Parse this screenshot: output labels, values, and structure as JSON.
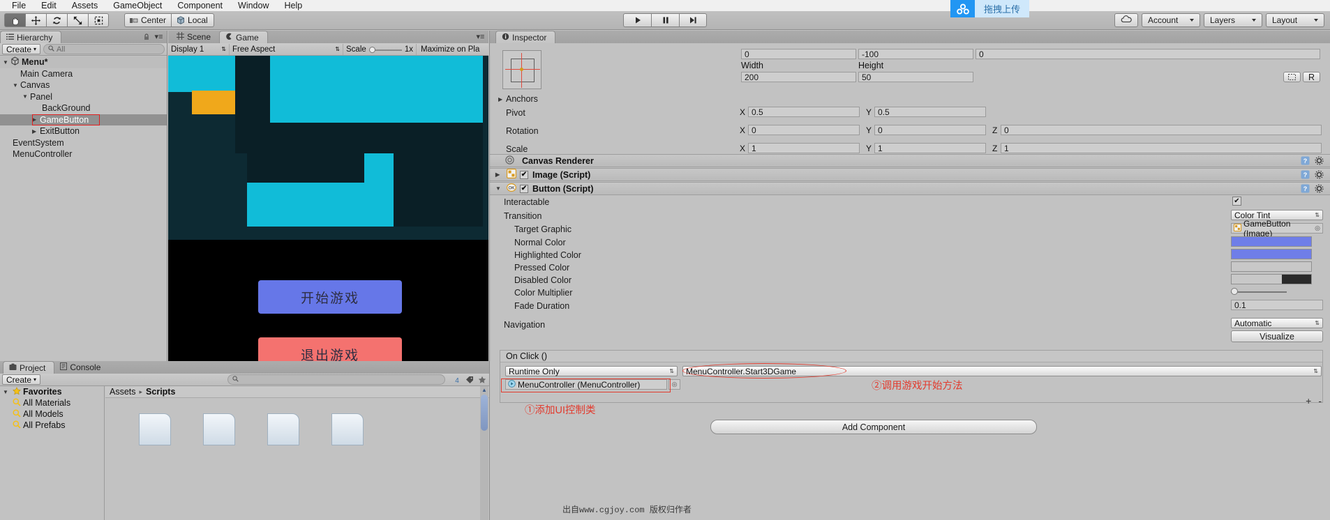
{
  "menubar": {
    "items": [
      "File",
      "Edit",
      "Assets",
      "GameObject",
      "Component",
      "Window",
      "Help"
    ]
  },
  "toolbar": {
    "tools": [
      {
        "name": "hand-tool",
        "icon": "hand-icon",
        "active": true
      },
      {
        "name": "move-tool",
        "icon": "move-arrows-icon",
        "active": false
      },
      {
        "name": "rotate-tool",
        "icon": "rotate-icon",
        "active": false
      },
      {
        "name": "scale-tool",
        "icon": "scale-icon",
        "active": false
      },
      {
        "name": "rect-tool",
        "icon": "rect-transform-icon",
        "active": false
      }
    ],
    "pivot_label": "Center",
    "space_label": "Local",
    "play_label": "play-icon",
    "pause_label": "pause-icon",
    "step_label": "step-icon",
    "cloud_label": "cloud-icon",
    "account_label": "Account",
    "layers_label": "Layers",
    "layout_label": "Layout"
  },
  "upload_widget": {
    "label": "拖拽上传",
    "icon": "cloud-upload-icon",
    "accent": "#2196f3"
  },
  "hierarchy": {
    "tab_label": "Hierarchy",
    "create_label": "Create",
    "search_placeholder": "All",
    "selected": "GameButton",
    "items": [
      {
        "label": "Menu*",
        "depth": 0,
        "arrow": "down",
        "root": true,
        "selected": false
      },
      {
        "label": "Main Camera",
        "depth": 1,
        "arrow": "none",
        "selected": false
      },
      {
        "label": "Canvas",
        "depth": 1,
        "arrow": "down",
        "selected": false
      },
      {
        "label": "Panel",
        "depth": 2,
        "arrow": "down",
        "selected": false
      },
      {
        "label": "BackGround",
        "depth": 3,
        "arrow": "none",
        "selected": false
      },
      {
        "label": "GameButton",
        "depth": 3,
        "arrow": "right",
        "selected": true
      },
      {
        "label": "ExitButton",
        "depth": 3,
        "arrow": "right",
        "selected": false
      },
      {
        "label": "EventSystem",
        "depth": 1,
        "arrow": "none",
        "selected": false
      },
      {
        "label": "MenuController",
        "depth": 1,
        "arrow": "none",
        "selected": false
      }
    ]
  },
  "scene_tab": {
    "label": "Scene"
  },
  "game_tab": {
    "label": "Game",
    "display_label": "Display 1",
    "aspect_label": "Free Aspect",
    "scale_label": "Scale",
    "scale_value": "1x",
    "maximize_label": "Maximize on Pla",
    "buttons": [
      {
        "label": "开始游戏",
        "color": "#6677e8",
        "text_color": "#2e2e42"
      },
      {
        "label": "退出游戏",
        "color": "#f4726f",
        "text_color": "#3a2a2a"
      }
    ]
  },
  "inspector": {
    "tab_label": "Inspector",
    "rect_transform": {
      "pos_x": "0",
      "pos_y": "-100",
      "pos_z": "0",
      "width_label": "Width",
      "height_label": "Height",
      "width": "200",
      "height": "50",
      "anchors_label": "Anchors",
      "pivot_label": "Pivot",
      "pivot_x": "0.5",
      "pivot_y": "0.5",
      "rotation_label": "Rotation",
      "rot_x": "0",
      "rot_y": "0",
      "rot_z": "0",
      "scale_label": "Scale",
      "scale_x": "1",
      "scale_y": "1",
      "scale_z": "1",
      "blueprint_label": "R"
    },
    "components": [
      {
        "name": "Canvas Renderer",
        "icon": "canvas-renderer-icon",
        "checkbox": false,
        "expanded": false
      },
      {
        "name": "Image (Script)",
        "icon": "image-script-icon",
        "checkbox": true,
        "expanded": false
      },
      {
        "name": "Button (Script)",
        "icon": "button-script-icon",
        "checkbox": true,
        "expanded": true
      }
    ],
    "button_script": {
      "interactable_label": "Interactable",
      "interactable_value": true,
      "transition_label": "Transition",
      "transition_value": "Color Tint",
      "target_graphic_label": "Target Graphic",
      "target_graphic_value": "GameButton (Image)",
      "normal_color_label": "Normal Color",
      "normal_color": "#6f7ee8",
      "highlighted_color_label": "Highlighted Color",
      "highlighted_color": "#6f7ee8",
      "pressed_color_label": "Pressed Color",
      "pressed_color": "#c8c8c8",
      "disabled_color_label": "Disabled Color",
      "disabled_color": "#c8c8c8",
      "color_multiplier_label": "Color Multiplier",
      "color_multiplier_value": "1",
      "fade_duration_label": "Fade Duration",
      "fade_duration_value": "0.1",
      "navigation_label": "Navigation",
      "navigation_value": "Automatic",
      "visualize_label": "Visualize"
    },
    "on_click": {
      "header": "On Click ()",
      "runtime_label": "Runtime Only",
      "function_label": "MenuController.Start3DGame",
      "object_label": "MenuController (MenuController)",
      "plus_label": "+",
      "minus_label": "-"
    },
    "add_component_label": "Add Component"
  },
  "annotations": [
    {
      "id": "note-1",
      "text": "①添加UI控制类",
      "color": "#e23b2e"
    },
    {
      "id": "note-2",
      "text": "②调用游戏开始方法",
      "color": "#e23b2e"
    }
  ],
  "project": {
    "project_tab": "Project",
    "console_tab": "Console",
    "create_label": "Create",
    "search_placeholder": "",
    "favorites_label": "Favorites",
    "favorites": [
      "All Materials",
      "All Models",
      "All Prefabs"
    ],
    "breadcrumb": [
      "Assets",
      "Scripts"
    ],
    "asset_count": 4
  },
  "watermark": {
    "text": "出自www.cgjoy.com 版权归作者"
  }
}
